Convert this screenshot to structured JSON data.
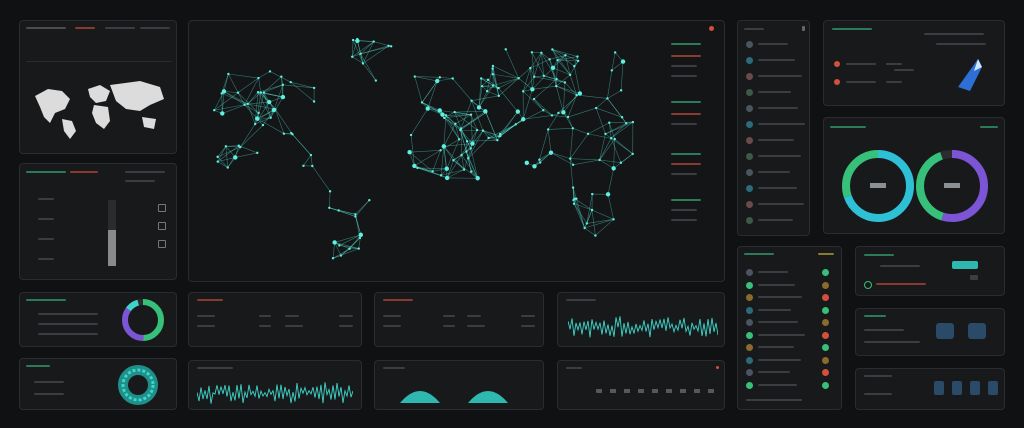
{
  "colors": {
    "background": "#101112",
    "panel": "#18191b",
    "accent_cyan": "#3fd4c8",
    "accent_green": "#36c07a",
    "accent_red": "#d2503c",
    "accent_purple": "#7b55d6",
    "accent_blue": "#2d6fd4"
  },
  "map_panel": {
    "node_color": "#5ef0e0",
    "status_dot_color": "#d2503c",
    "icon": "world-network-icon"
  },
  "small_map_panel": {
    "icon": "world-map-icon"
  },
  "donut_small": {
    "icon": "ring-chart-icon",
    "level": 0.85
  },
  "donut_pair": {
    "icon": "ring-chart-icon",
    "left_level": 0.7,
    "right_level": 0.55
  },
  "waveforms": {
    "icon": "waveform-icon"
  },
  "wifi_icon": "wifi-signal-icon",
  "arcs": {
    "icon": "arc-gauge-icon"
  },
  "device_icons": {
    "icon": "tile-icon"
  },
  "security_icon": "shield-cursor-icon",
  "progress_column": {
    "level": 0.55
  }
}
